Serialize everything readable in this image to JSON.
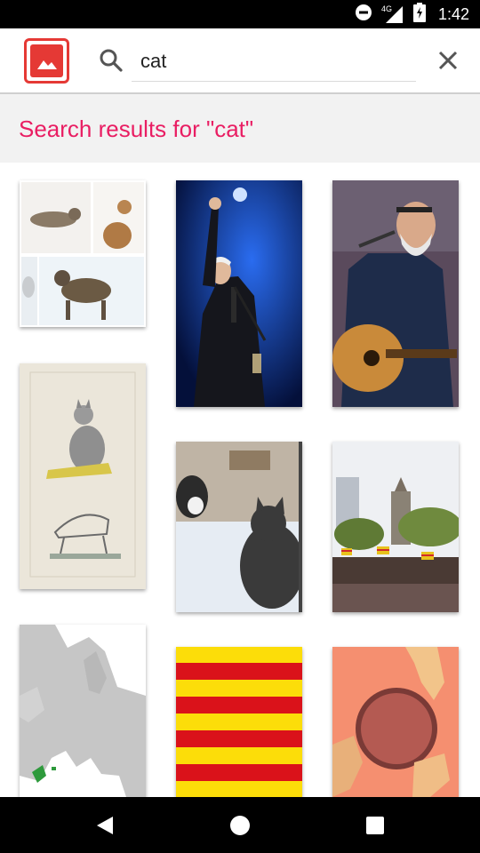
{
  "status_bar": {
    "network_label": "4G",
    "time": "1:42",
    "icons": [
      "do-not-disturb-icon",
      "signal-icon",
      "battery-icon"
    ]
  },
  "app_bar": {
    "logo_icon": "image-icon",
    "search": {
      "value": "cat",
      "placeholder": ""
    },
    "search_icon": "search-icon",
    "clear_icon": "close-icon"
  },
  "results": {
    "title": "Search results for \"cat\"",
    "accent_color": "#e91e63",
    "tiles": [
      {
        "name": "cat-collage"
      },
      {
        "name": "singer-on-stage"
      },
      {
        "name": "guitarist-with-microphone"
      },
      {
        "name": "cat-anatomy-illustration"
      },
      {
        "name": "cats-at-window"
      },
      {
        "name": "street-demonstration"
      },
      {
        "name": "europe-map"
      },
      {
        "name": "catalan-flag"
      },
      {
        "name": "hands-holding-sphere"
      }
    ]
  },
  "nav_bar": {
    "back_icon": "back-icon",
    "home_icon": "home-icon",
    "recents_icon": "recents-icon"
  }
}
